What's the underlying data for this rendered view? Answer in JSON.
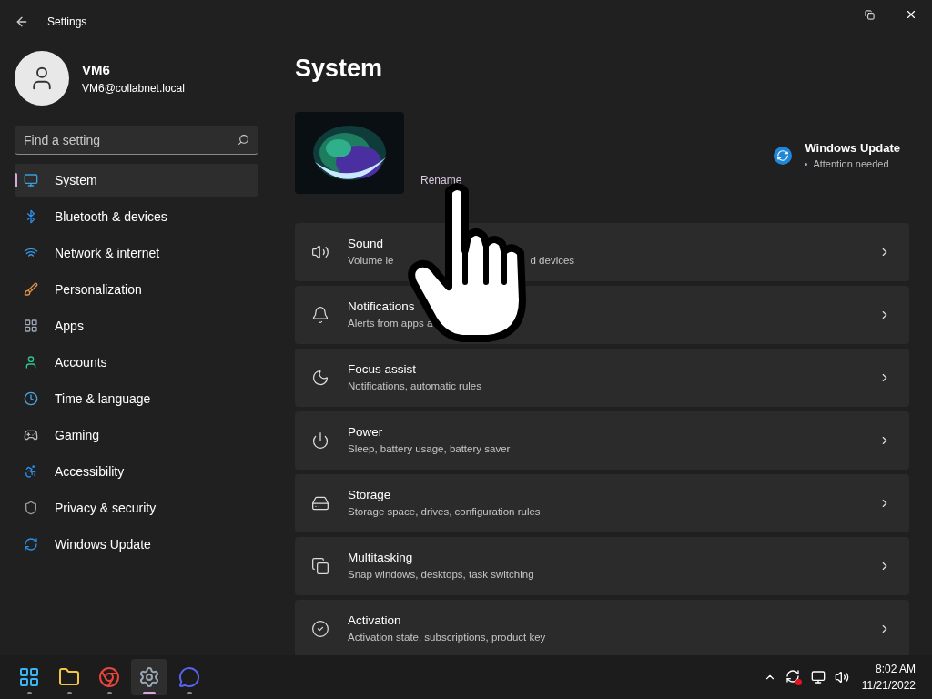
{
  "window": {
    "title": "Settings"
  },
  "account": {
    "name": "VM6",
    "email": "VM6@collabnet.local"
  },
  "search": {
    "placeholder": "Find a setting"
  },
  "sidebar": {
    "items": [
      {
        "label": "System",
        "selected": true
      },
      {
        "label": "Bluetooth & devices",
        "selected": false
      },
      {
        "label": "Network & internet",
        "selected": false
      },
      {
        "label": "Personalization",
        "selected": false
      },
      {
        "label": "Apps",
        "selected": false
      },
      {
        "label": "Accounts",
        "selected": false
      },
      {
        "label": "Time & language",
        "selected": false
      },
      {
        "label": "Gaming",
        "selected": false
      },
      {
        "label": "Accessibility",
        "selected": false
      },
      {
        "label": "Privacy & security",
        "selected": false
      },
      {
        "label": "Windows Update",
        "selected": false
      }
    ]
  },
  "page": {
    "title": "System",
    "rename": "Rename",
    "update": {
      "title": "Windows Update",
      "status": "Attention needed"
    }
  },
  "cards": [
    {
      "title": "Sound",
      "subtitle_parts": [
        "Volume le",
        "d devices"
      ]
    },
    {
      "title": "Notifications",
      "subtitle_parts": [
        "Alerts from apps a"
      ]
    },
    {
      "title": "Focus assist",
      "subtitle_parts": [
        "Notifications, automatic rules"
      ]
    },
    {
      "title": "Power",
      "subtitle_parts": [
        "Sleep, battery usage, battery saver"
      ]
    },
    {
      "title": "Storage",
      "subtitle_parts": [
        "Storage space, drives, configuration rules"
      ]
    },
    {
      "title": "Multitasking",
      "subtitle_parts": [
        "Snap windows, desktops, task switching"
      ]
    },
    {
      "title": "Activation",
      "subtitle_parts": [
        "Activation state, subscriptions, product key"
      ]
    }
  ],
  "taskbar": {
    "apps": [
      {
        "selected": false
      },
      {
        "selected": false
      },
      {
        "selected": false
      },
      {
        "selected": true
      },
      {
        "selected": false
      }
    ],
    "time": "8:02 AM",
    "date": "11/21/2022"
  }
}
